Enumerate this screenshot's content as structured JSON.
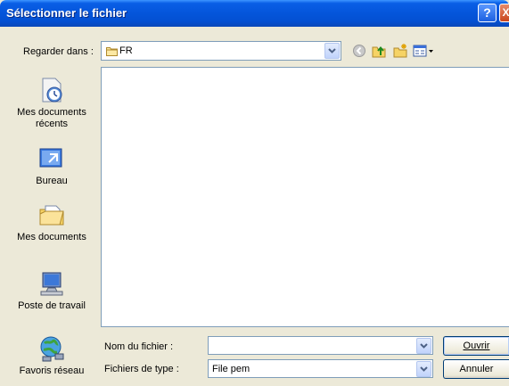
{
  "window": {
    "title": "Sélectionner le fichier",
    "help_glyph": "?",
    "close_glyph": "X"
  },
  "lookin": {
    "label": "Regarder dans :",
    "value": "FR"
  },
  "toolbar": {
    "icons": [
      "back-icon",
      "up-folder-icon",
      "new-folder-icon",
      "view-menu-icon"
    ]
  },
  "places": [
    {
      "label_line1": "Mes documents",
      "label_line2": "récents",
      "icon": "recent-documents-icon"
    },
    {
      "label_line1": "Bureau",
      "label_line2": "",
      "icon": "desktop-icon"
    },
    {
      "label_line1": "Mes documents",
      "label_line2": "",
      "icon": "my-documents-icon"
    },
    {
      "label_line1": "Poste de travail",
      "label_line2": "",
      "icon": "my-computer-icon"
    },
    {
      "label_line1": "Favoris réseau",
      "label_line2": "",
      "icon": "network-places-icon"
    }
  ],
  "filename": {
    "label": "Nom du fichier :",
    "value": ""
  },
  "filetype": {
    "label": "Fichiers de type :",
    "value": "File pem"
  },
  "buttons": {
    "open": "Ouvrir",
    "cancel": "Annuler"
  },
  "colors": {
    "titlebar": "#0556dc",
    "dialog_bg": "#ece9d8",
    "field_border": "#7f9db9"
  }
}
